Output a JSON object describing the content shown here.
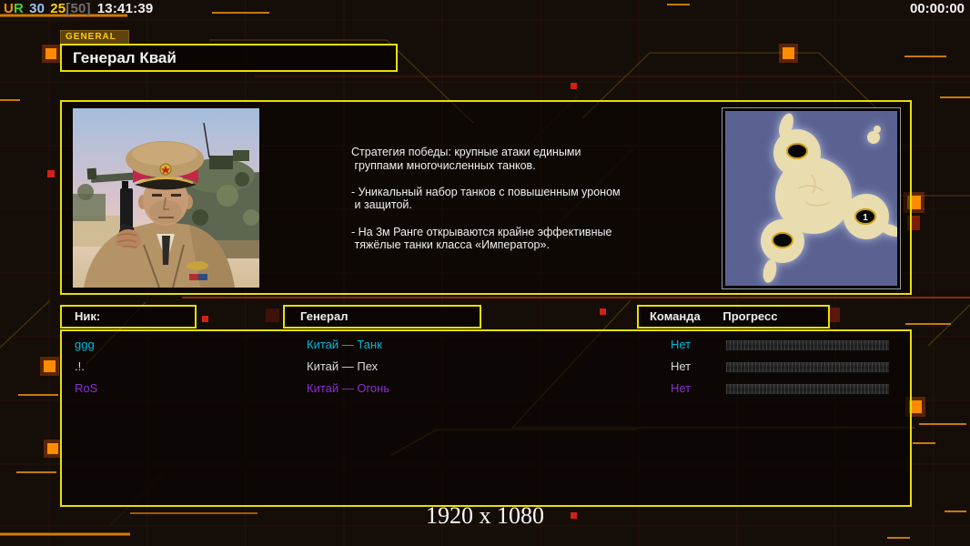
{
  "colors": {
    "accent_yellow": "#e8e000",
    "accent_orange": "#ff8c00",
    "row_cyan": "#00b9dd",
    "row_white": "#dadada",
    "row_purple": "#8b2fd0"
  },
  "status_bar": {
    "label_u": "U",
    "label_r": "R",
    "stat_blue": "30",
    "stat_yellow": "25",
    "stat_gray": "[50]",
    "clock": "13:41:39",
    "match_timer": "00:00:00"
  },
  "general_panel": {
    "tab": "GENERAL",
    "title": "Генерал Квай",
    "description_lines": [
      "Стратегия победы: крупные атаки едиными",
      " группами многочисленных танков.",
      "",
      "- Уникальный набор танков с повышенным уроном",
      " и защитой.",
      "",
      "- На 3м Ранге открываются крайне эффективные",
      " тяжёлые танки класса «Император»."
    ]
  },
  "map_preview": {
    "spawn_point_label": "1"
  },
  "players": {
    "headers": {
      "nick": "Ник:",
      "general": "Генерал",
      "team": "Команда",
      "progress": "Прогресс"
    },
    "rows": [
      {
        "nick": "ggg",
        "general": "Китай — Танк",
        "team": "Нет"
      },
      {
        "nick": ".!.",
        "general": "Китай — Пех",
        "team": "Нет"
      },
      {
        "nick": "RoS",
        "general": "Китай — Огонь",
        "team": "Нет"
      }
    ]
  },
  "footer": {
    "resolution": "1920 x 1080"
  }
}
